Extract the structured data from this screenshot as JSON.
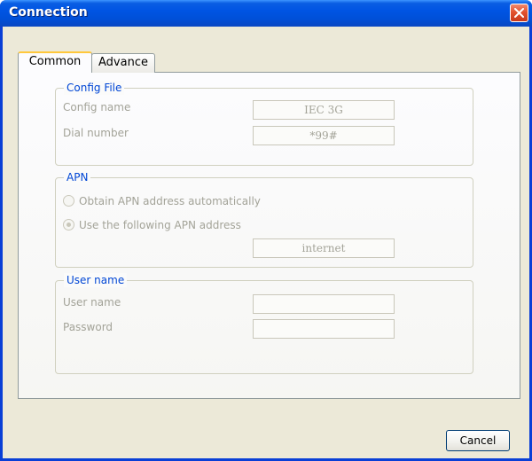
{
  "window": {
    "title": "Connection"
  },
  "tabs": [
    {
      "label": "Common",
      "selected": true
    },
    {
      "label": "Advance",
      "selected": false
    }
  ],
  "config_file": {
    "legend": "Config File",
    "config_name_label": "Config name",
    "config_name_value": "IEC 3G",
    "dial_number_label": "Dial number",
    "dial_number_value": "*99#"
  },
  "apn": {
    "legend": "APN",
    "option_auto_label": "Obtain APN address automatically",
    "option_manual_label": "Use the following APN address",
    "selected_option": "manual",
    "apn_value": "internet"
  },
  "user": {
    "legend": "User name",
    "user_name_label": "User name",
    "user_name_value": "",
    "password_label": "Password",
    "password_value": ""
  },
  "buttons": {
    "cancel_label": "Cancel"
  },
  "colors": {
    "titlebar": "#0054e3",
    "legend_text": "#0046d5",
    "disabled_text": "#a3a398",
    "selected_tab_highlight": "#ffc83c",
    "close_button": "#e2522f"
  }
}
